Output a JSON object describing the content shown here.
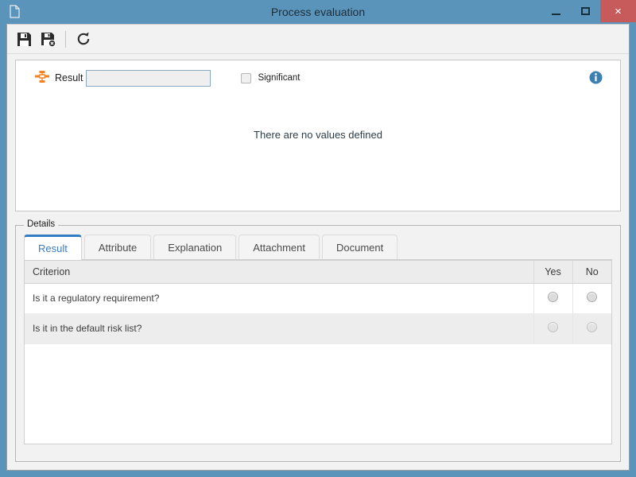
{
  "window": {
    "title": "Process evaluation",
    "doc_icon": "document-icon",
    "minimize_label": "",
    "maximize_label": "",
    "close_label": "×",
    "titlebar_color": "#5b94bb",
    "close_color": "#c75b5b"
  },
  "toolbar": {
    "items": [
      {
        "name": "save-button",
        "icon": "save-icon",
        "label": ""
      },
      {
        "name": "save-and-close-button",
        "icon": "save-close-icon",
        "label": ""
      },
      {
        "name": "refresh-button",
        "icon": "refresh-icon",
        "label": ""
      }
    ]
  },
  "upper_panel": {
    "result_icon": "hierarchy-icon",
    "result_icon_color": "#f58220",
    "result_label": "Result",
    "result_value": "",
    "result_placeholder": "",
    "significant_label": "Significant",
    "significant_checked": false,
    "info_icon": "info-icon",
    "info_icon_color": "#3c7fb1",
    "empty_message": "There are no values defined"
  },
  "details": {
    "legend": "Details",
    "tabs": [
      {
        "label": "Result",
        "active": true
      },
      {
        "label": "Attribute",
        "active": false
      },
      {
        "label": "Explanation",
        "active": false
      },
      {
        "label": "Attachment",
        "active": false
      },
      {
        "label": "Document",
        "active": false
      }
    ],
    "table": {
      "columns": [
        "Criterion",
        "Yes",
        "No"
      ],
      "rows": [
        {
          "criterion": "Is it a regulatory requirement?",
          "yes": false,
          "no": false
        },
        {
          "criterion": "Is it in the default risk list?",
          "yes": false,
          "no": false
        }
      ]
    }
  }
}
